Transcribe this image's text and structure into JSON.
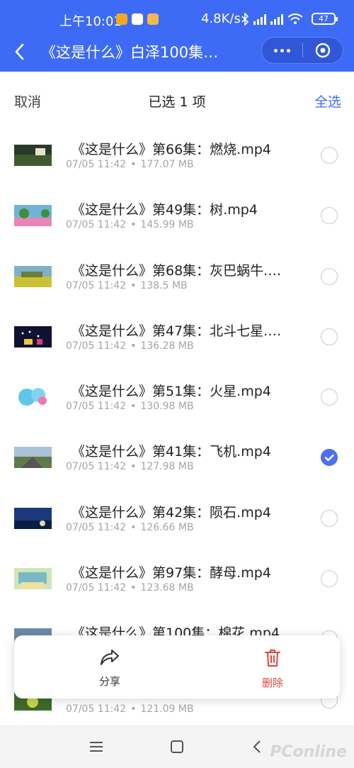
{
  "status": {
    "time": "上午10:01",
    "network_speed": "4.8K/s",
    "battery": "47"
  },
  "nav": {
    "title": "《这是什么》白泽100集…"
  },
  "selection": {
    "cancel_label": "取消",
    "count_label": "已选 1 项",
    "select_all_label": "全选"
  },
  "files": [
    {
      "name": "《这是什么》第66集：燃烧.mp4",
      "date": "07/05 11:42",
      "size": "177.07 MB",
      "selected": false
    },
    {
      "name": "《这是什么》第49集：树.mp4",
      "date": "07/05 11:42",
      "size": "145.99 MB",
      "selected": false
    },
    {
      "name": "《这是什么》第68集：灰巴蜗牛.…",
      "date": "07/05 11:42",
      "size": "138.5 MB",
      "selected": false
    },
    {
      "name": "《这是什么》第47集：北斗七星.…",
      "date": "07/05 11:42",
      "size": "136.28 MB",
      "selected": false
    },
    {
      "name": "《这是什么》第51集：火星.mp4",
      "date": "07/05 11:42",
      "size": "130.98 MB",
      "selected": false
    },
    {
      "name": "《这是什么》第41集：飞机.mp4",
      "date": "07/05 11:42",
      "size": "127.98 MB",
      "selected": true
    },
    {
      "name": "《这是什么》第42集：陨石.mp4",
      "date": "07/05 11:42",
      "size": "126.66 MB",
      "selected": false
    },
    {
      "name": "《这是什么》第97集：酵母.mp4",
      "date": "07/05 11:42",
      "size": "123.68 MB",
      "selected": false
    },
    {
      "name": "《这是什么》第100集：棉花.mp4",
      "date": "",
      "size": "",
      "selected": false
    },
    {
      "name": "",
      "date": "07/05 11:42",
      "size": "121.09 MB",
      "selected": false
    }
  ],
  "actions": {
    "share_label": "分享",
    "delete_label": "删除"
  },
  "watermark": "PConline",
  "colors": {
    "accent": "#3d6bf5",
    "delete": "#e0463a",
    "checked": "#4d6ff0"
  }
}
